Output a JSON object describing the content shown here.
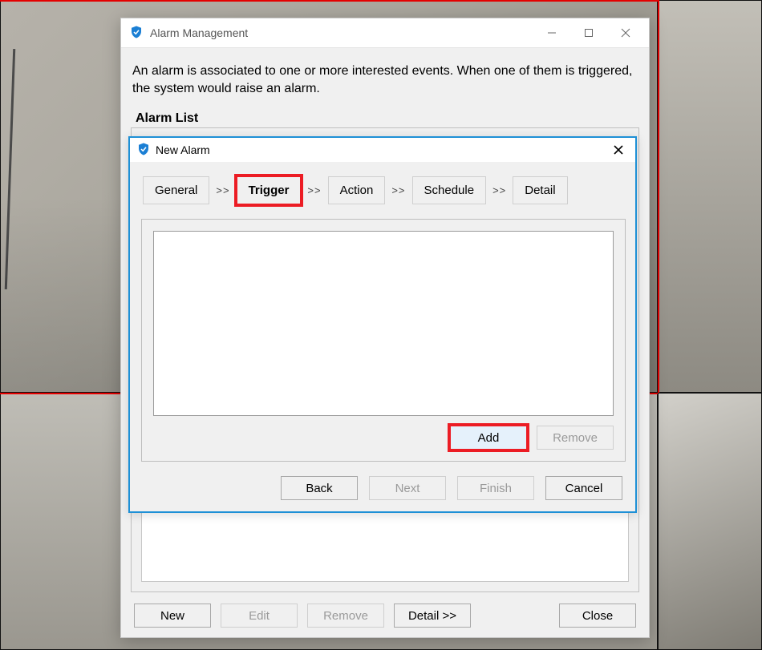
{
  "parent_dialog": {
    "title": "Alarm Management",
    "intro": "An alarm is associated to one or more interested events. When one of them is triggered, the system would raise an alarm.",
    "section_label": "Alarm List",
    "buttons": {
      "new": "New",
      "edit": "Edit",
      "remove": "Remove",
      "detail": "Detail >>",
      "close": "Close"
    }
  },
  "inner_dialog": {
    "title": "New Alarm",
    "steps": {
      "general": "General",
      "trigger": "Trigger",
      "action": "Action",
      "schedule": "Schedule",
      "detail": "Detail",
      "separator": ">>"
    },
    "active_step": "trigger",
    "list_buttons": {
      "add": "Add",
      "remove": "Remove"
    },
    "nav_buttons": {
      "back": "Back",
      "next": "Next",
      "finish": "Finish",
      "cancel": "Cancel"
    }
  }
}
